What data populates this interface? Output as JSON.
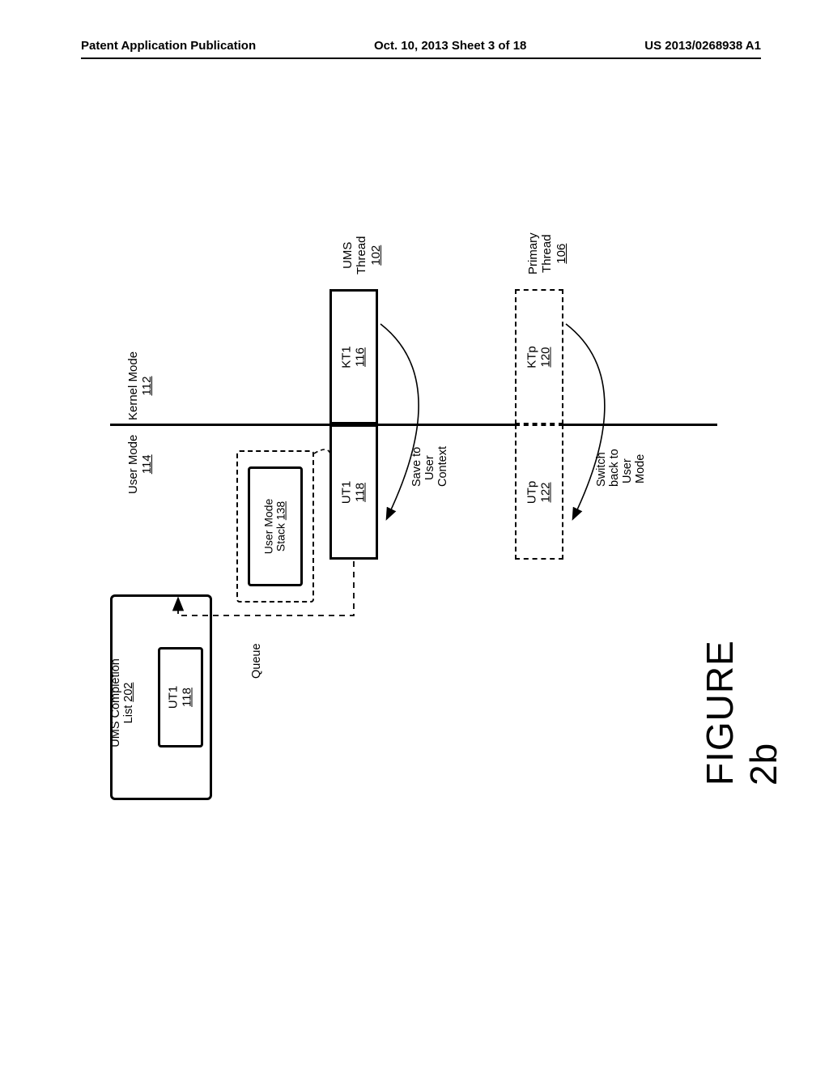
{
  "header": {
    "left": "Patent Application Publication",
    "center": "Oct. 10, 2013  Sheet 3 of 18",
    "right": "US 2013/0268938 A1"
  },
  "modes": {
    "kernel": {
      "label": "Kernel Mode",
      "ref": "112"
    },
    "user": {
      "label": "User Mode",
      "ref": "114"
    }
  },
  "threads": {
    "ums": {
      "title": "UMS\nThread",
      "ref": "102",
      "kt": {
        "name": "KT1",
        "ref": "116"
      },
      "ut": {
        "name": "UT1",
        "ref": "118"
      }
    },
    "primary": {
      "title": "Primary\nThread",
      "ref": "106",
      "kt": {
        "name": "KTp",
        "ref": "120"
      },
      "ut": {
        "name": "UTp",
        "ref": "122"
      }
    }
  },
  "completion_list": {
    "label": "UMS Completion\nList",
    "ref": "202",
    "item": {
      "name": "UT1",
      "ref": "118"
    }
  },
  "user_stack": {
    "label": "User Mode\nStack",
    "ref": "138"
  },
  "annotations": {
    "queue": "Queue",
    "save_context": "Save to\n  User\nContext",
    "switch_back": "Switch\nback to\n User\n Mode"
  },
  "figure_label": "FIGURE 2b",
  "chart_data": {
    "type": "diagram",
    "title": "FIGURE 2b",
    "description": "User Mode Scheduling (UMS) thread transition diagram showing kernel/user mode portions of a UMS thread and a Primary thread, saving user context, a UMS completion list queue, and switching back to user mode.",
    "horizontal_divider": {
      "separates": [
        "Kernel Mode 112",
        "User Mode 114"
      ]
    },
    "columns": [
      {
        "name": "UMS Thread",
        "ref": "102",
        "kernel_half": {
          "name": "KT1",
          "ref": "116"
        },
        "user_half": {
          "name": "UT1",
          "ref": "118"
        }
      },
      {
        "name": "Primary Thread",
        "ref": "106",
        "kernel_half": {
          "name": "KTp",
          "ref": "120"
        },
        "user_half": {
          "name": "UTp",
          "ref": "122"
        }
      }
    ],
    "boxes": [
      {
        "name": "UMS Completion List",
        "ref": "202",
        "contains": [
          {
            "name": "UT1",
            "ref": "118"
          }
        ]
      },
      {
        "name": "User Mode Stack",
        "ref": "138"
      }
    ],
    "arrows": [
      {
        "from": "UMS Thread KT1 (kernel)",
        "to": "UMS Thread UT1 (user)",
        "label": "Save to User Context",
        "style": "curved"
      },
      {
        "from": "UMS Thread UT1",
        "to": "UMS Completion List 202",
        "label": "Queue",
        "style": "dashed"
      },
      {
        "from": "Primary Thread KTp (kernel)",
        "to": "Primary Thread UTp (user)",
        "label": "Switch back to User Mode",
        "style": "curved"
      },
      {
        "from": "User Mode Stack 138",
        "to": "UMS Thread UT1",
        "label": "",
        "style": "dashed-connector"
      }
    ]
  }
}
